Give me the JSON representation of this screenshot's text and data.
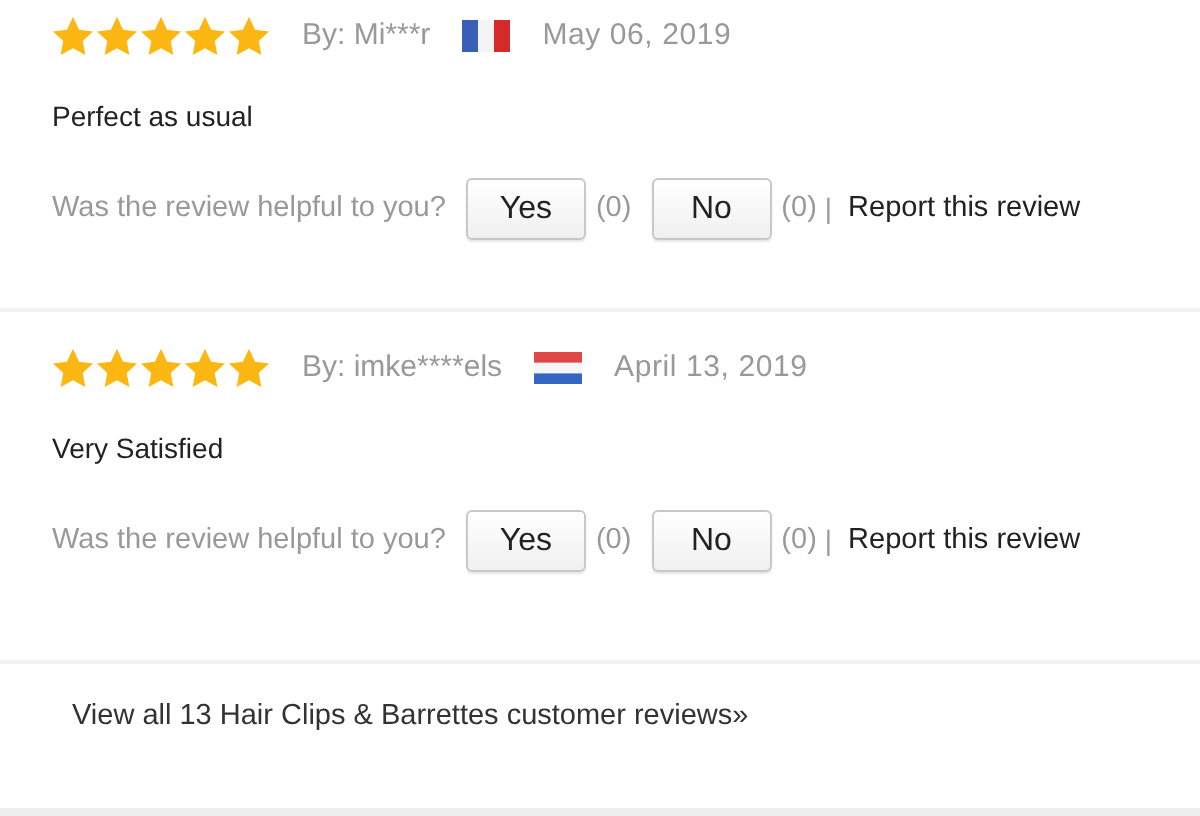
{
  "reviews": [
    {
      "stars": 5,
      "author": "By: Mi***r",
      "flag": {
        "kind": "vertical"
      },
      "date": "May 06, 2019",
      "text": "Perfect as usual",
      "helpful_prompt": "Was the review helpful to you?",
      "yes_label": "Yes",
      "yes_count": "(0)",
      "no_label": "No",
      "no_count": "(0)",
      "separator": "|",
      "report": "Report this review"
    },
    {
      "stars": 5,
      "author": "By: imke****els",
      "flag": {
        "kind": "horizontal"
      },
      "date": "April 13, 2019",
      "text": "Very Satisfied",
      "helpful_prompt": "Was the review helpful to you?",
      "yes_label": "Yes",
      "yes_count": "(0)",
      "no_label": "No",
      "no_count": "(0)",
      "separator": "|",
      "report": "Report this review"
    }
  ],
  "view_all": "View all 13 Hair Clips & Barrettes customer reviews»"
}
